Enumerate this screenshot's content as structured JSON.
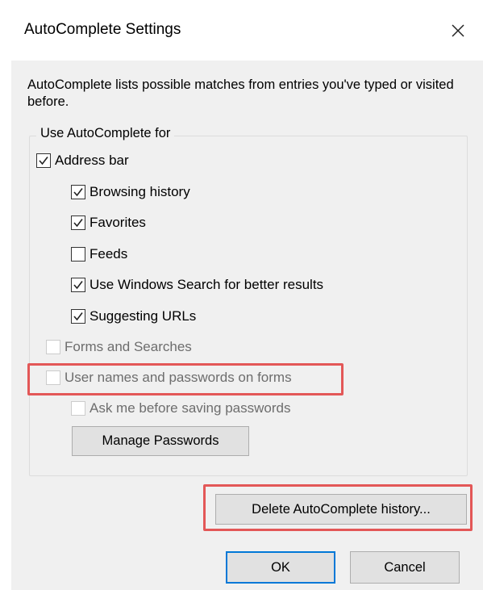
{
  "window": {
    "title": "AutoComplete Settings",
    "close_icon": "close-icon"
  },
  "intro_text": "AutoComplete lists possible matches from entries you've typed or visited before.",
  "group": {
    "label": "Use AutoComplete for",
    "options": {
      "address_bar": {
        "label": "Address bar",
        "checked": true,
        "enabled": true
      },
      "browsing_history": {
        "label": "Browsing history",
        "checked": true,
        "enabled": true
      },
      "favorites": {
        "label": "Favorites",
        "checked": true,
        "enabled": true
      },
      "feeds": {
        "label": "Feeds",
        "checked": false,
        "enabled": true
      },
      "windows_search": {
        "label": "Use Windows Search for better results",
        "checked": true,
        "enabled": true
      },
      "suggesting_urls": {
        "label": "Suggesting URLs",
        "checked": true,
        "enabled": true
      },
      "forms_searches": {
        "label": "Forms and Searches",
        "checked": false,
        "enabled": false
      },
      "usernames_passwords": {
        "label": "User names and passwords on forms",
        "checked": false,
        "enabled": false
      },
      "ask_before_saving": {
        "label": "Ask me before saving passwords",
        "checked": false,
        "enabled": false
      }
    },
    "manage_passwords_label": "Manage Passwords"
  },
  "buttons": {
    "delete_history_label": "Delete AutoComplete history...",
    "ok_label": "OK",
    "cancel_label": "Cancel"
  },
  "colors": {
    "highlight": "#e35757",
    "default_button_border": "#0078d7",
    "client_background": "#f0f0f0"
  }
}
